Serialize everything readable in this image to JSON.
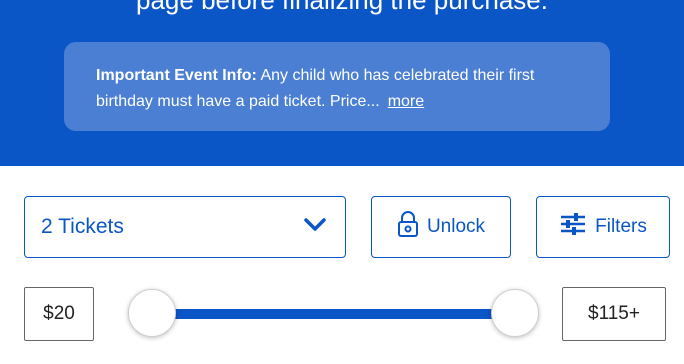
{
  "header": {
    "partial_text": "page before finalizing the purchase."
  },
  "info_banner": {
    "label": "Important Event Info:",
    "message": "Any child who has celebrated their first birthday must have a paid ticket. Price...",
    "more_link": "more"
  },
  "controls": {
    "ticket_quantity": "2 Tickets",
    "unlock_label": "Unlock",
    "filters_label": "Filters"
  },
  "price_filter": {
    "min_label": "$20",
    "max_label": "$115+",
    "min_value": 20,
    "max_value": 115
  },
  "colors": {
    "brand_blue": "#0b56c7",
    "banner_blue": "#4a7fd3"
  },
  "icons": {
    "dropdown": "chevron-down-icon",
    "unlock": "lock-icon",
    "filters": "sliders-icon"
  }
}
